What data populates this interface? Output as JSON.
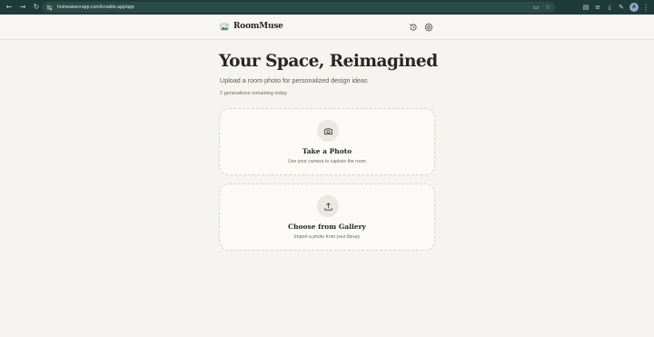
{
  "browser": {
    "url": "homeaisecrapp.com/lovable.app/app",
    "profile_initial": "A"
  },
  "app": {
    "brand_name": "RoomMuse",
    "history_icon": "history-icon",
    "settings_icon": "gear-icon"
  },
  "main": {
    "title": "Your Space, Reimagined",
    "subtitle": "Upload a room photo for personalized design ideas",
    "remaining": "2 generations remaining today"
  },
  "cards": {
    "photo": {
      "icon": "camera-icon",
      "title": "Take a Photo",
      "description": "Use your camera to capture the room"
    },
    "gallery": {
      "icon": "upload-icon",
      "title": "Choose from Gallery",
      "description": "Import a photo from your library"
    }
  },
  "colors": {
    "background": "#f6f4f0",
    "browser_bar": "#1f3b38",
    "text": "#2a2622",
    "card_border": "#d6d0c8"
  }
}
